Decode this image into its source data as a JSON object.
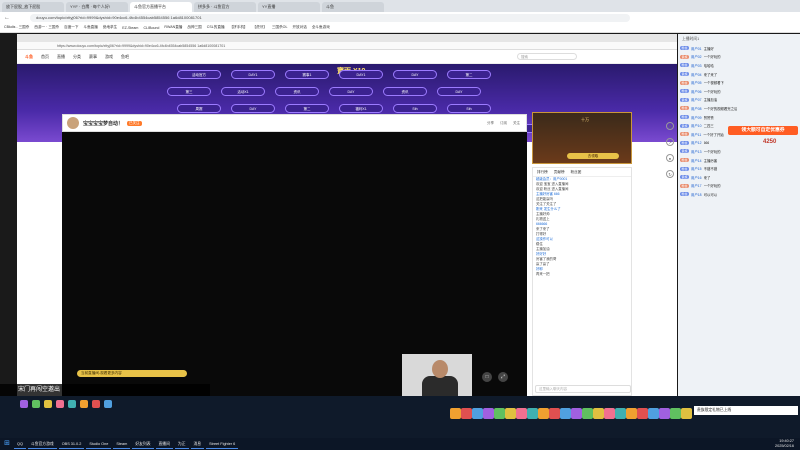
{
  "outer_tabs": [
    "放下屁股_放下屁股",
    "YYF · 白鹰 · 每个人好!",
    "斗鱼官方直播平台",
    "拼多多 · 斗鱼官方",
    "YY直播",
    "斗鱼"
  ],
  "outer_address": "douyu.com/topic/xttyj06?rid=9999&dyshid=90e4cc6-4fc4b4554cab5854556 1a6d8100081701",
  "bookmarks": [
    "CBkdis - 三国杀",
    "西游一 · 三国杀",
    "百度一下",
    "斗鱼直播",
    "绝地求生",
    "EZ-Steam",
    "CLIBound",
    "RWAN直播",
    "战神三国",
    "CSL的直播",
    "【拼手机】",
    "【虎牙】",
    "三国杀OL",
    "开放对话",
    "全斗鱼游戏"
  ],
  "inner": {
    "address": "https://www.douyu.com/topic/xttyj06?rid=9999&dyshid=90e4cc6-4fc4b4554cab5854556 1a6d8100081701",
    "logo": "斗鱼",
    "nav": [
      "首页",
      "直播",
      "分类",
      "赛事",
      "游戏",
      "鱼吧"
    ],
    "search_placeholder": "搜索"
  },
  "banner": {
    "title": "寶雨 X19",
    "pills": [
      "活动官方",
      "DAY1",
      "赛事1",
      "DAY1",
      "DAY",
      "第二",
      "第三",
      "活动X1",
      "资讯",
      "DAY",
      "资讯",
      "DAY",
      "周赛",
      "DAY",
      "第二",
      "福利X1",
      "Sth",
      "Sth",
      "Galaxy赛",
      "首页",
      "新大赛",
      "DAY1",
      "赛事",
      "第二"
    ]
  },
  "room": {
    "name": "宝宝宝宝梦自动！",
    "badge": "已关注",
    "stats": [
      "分享",
      "订阅",
      "关注"
    ],
    "video_bar": "当前直播间-观看更多内容"
  },
  "rank_card": {
    "title": "十万",
    "button": "去领取"
  },
  "chat": {
    "tabs": [
      "排行榜",
      "贡献榜",
      "粉丝团"
    ],
    "lines": [
      "超级会员：用户0001",
      "欢迎 宝宝 进入直播间",
      "欢迎 粉丝 进入直播间",
      "主播好厉害 666",
      "这把能赢吗",
      "关注了关注了",
      "刚来 发生什么了",
      "主播好帅",
      "礼物送上",
      "666666",
      "来了来了",
      "打得好",
      "这操作可以",
      "稳住",
      "主播加油",
      "好好好",
      "厉害了我的哥",
      "赢了赢了",
      "好耶",
      "再来一把"
    ],
    "input_placeholder": "这里输入聊天内容"
  },
  "right_panel": {
    "header": "上播时间1",
    "promo": "领大额可自定优惠券",
    "count": "4250",
    "rows": [
      {
        "tag": "粉丝",
        "name": "用户01",
        "msg": "主播好"
      },
      {
        "tag": "贵族",
        "name": "用户02",
        "msg": "一个好玩的"
      },
      {
        "tag": "粉丝",
        "name": "用户03",
        "msg": "哈哈哈"
      },
      {
        "tag": "贵族",
        "name": "用户04",
        "msg": "来了来了"
      },
      {
        "tag": "粉丝",
        "name": "用户05",
        "msg": "一个视频看下"
      },
      {
        "tag": "粉丝",
        "name": "用户06",
        "msg": "一个好玩的"
      },
      {
        "tag": "贵族",
        "name": "用户07",
        "msg": "主播加油"
      },
      {
        "tag": "粉丝",
        "name": "用户08",
        "msg": "一个好的视频看完之后"
      },
      {
        "tag": "粉丝",
        "name": "用户09",
        "msg": "赞赞赞"
      },
      {
        "tag": "贵族",
        "name": "用户10",
        "msg": "二四三"
      },
      {
        "tag": "粉丝",
        "name": "用户11",
        "msg": "一个好了开始"
      },
      {
        "tag": "粉丝",
        "name": "用户12",
        "msg": "666"
      },
      {
        "tag": "贵族",
        "name": "用户13",
        "msg": "一个好玩的"
      },
      {
        "tag": "粉丝",
        "name": "用户14",
        "msg": "主播厉害"
      },
      {
        "tag": "粉丝",
        "name": "用户15",
        "msg": "不错不错"
      },
      {
        "tag": "贵族",
        "name": "用户16",
        "msg": "来了"
      },
      {
        "tag": "粉丝",
        "name": "用户17",
        "msg": "一个好玩的"
      },
      {
        "tag": "粉丝",
        "name": "用户18",
        "msg": "可以可以"
      }
    ]
  },
  "stream_title": "宋门再闯空邀出",
  "marquee": "贵族限定礼物已上线",
  "taskbar": {
    "items": [
      "QQ",
      "斗鱼官方游戏",
      "OBS 31.0.2",
      "Studio One",
      "Steam",
      "好友列表",
      "直播间",
      "为正",
      "消息",
      "Street Fighter 6"
    ],
    "time": "19:40:27",
    "date": "2025/02/16"
  }
}
